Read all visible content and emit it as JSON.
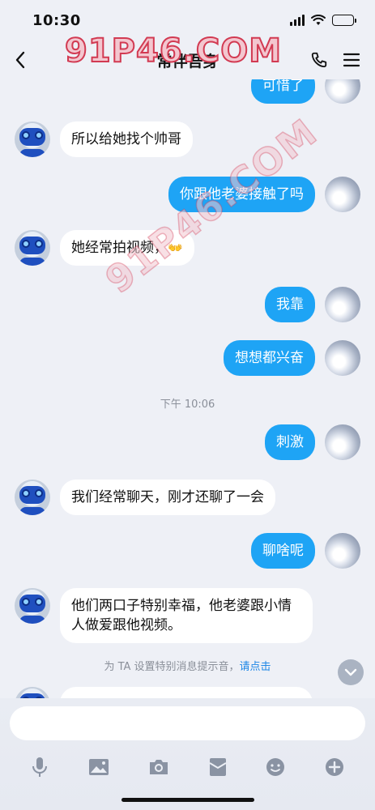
{
  "status": {
    "time": "10:30"
  },
  "header": {
    "title": "常伴吾身"
  },
  "watermark": {
    "main": "91P46.COM",
    "diagonal": "91P46.COM"
  },
  "messages": [
    {
      "dir": "out",
      "text": "可惜了"
    },
    {
      "dir": "in",
      "text": "所以给她找个帅哥"
    },
    {
      "dir": "out",
      "text": "你跟他老婆接触了吗"
    },
    {
      "dir": "in",
      "text": "她经常拍视频，",
      "emoji": "👐"
    },
    {
      "dir": "out",
      "text": "我靠"
    },
    {
      "dir": "out",
      "text": "想想都兴奋"
    },
    {
      "dir": "out",
      "text": "刺激"
    },
    {
      "dir": "in",
      "text": "我们经常聊天，刚才还聊了一会"
    },
    {
      "dir": "out",
      "text": "聊啥呢"
    },
    {
      "dir": "in",
      "text": "他们两口子特别幸福，他老婆跟小情人做爱跟他视频。"
    }
  ],
  "time_separator": "下午 10:06",
  "system_tip": {
    "text": "为 TA 设置特别消息提示音，",
    "link": "请点击"
  },
  "input": {
    "value": "",
    "placeholder": ""
  },
  "toolbar": [
    "mic-icon",
    "image-icon",
    "camera-icon",
    "red-packet-icon",
    "emoji-icon",
    "plus-icon"
  ]
}
